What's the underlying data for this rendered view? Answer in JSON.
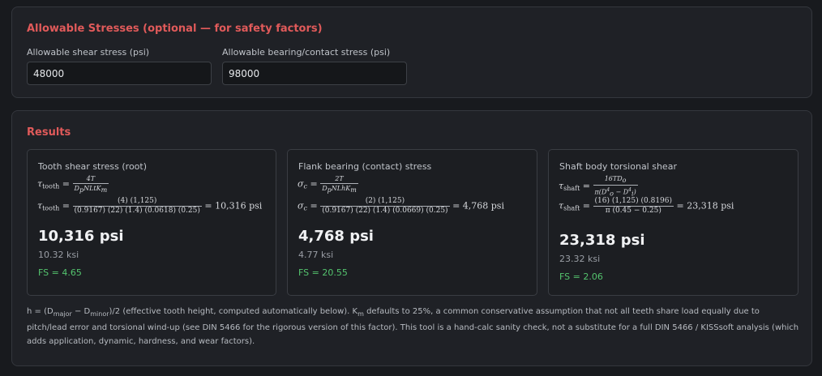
{
  "allowable": {
    "title": "Allowable Stresses (optional — for safety factors)",
    "shear_label": "Allowable shear stress (psi)",
    "shear_value": "48000",
    "bearing_label": "Allowable bearing/contact stress (psi)",
    "bearing_value": "98000"
  },
  "results": {
    "title": "Results",
    "cards": [
      {
        "title": "Tooth shear stress (root)",
        "sym": "τ",
        "sub": "tooth",
        "gen_num": "4T",
        "gen_den": "D",
        "gen_den_sub": "p",
        "gen_den_rest": "NLtK",
        "gen_den_sub2": "m",
        "num": "(4) (1,125)",
        "den": "(0.9167) (22) (1.4) (0.0618) (0.25)",
        "result": "= 10,316 psi",
        "big": "10,316 psi",
        "ksi": "10.32 ksi",
        "fs": "FS = 4.65"
      },
      {
        "title": "Flank bearing (contact) stress",
        "sym": "σ",
        "sub": "c",
        "gen_num": "2T",
        "gen_den": "D",
        "gen_den_sub": "p",
        "gen_den_rest": "NLhK",
        "gen_den_sub2": "m",
        "num": "(2) (1,125)",
        "den": "(0.9167) (22) (1.4) (0.0669) (0.25)",
        "result": "= 4,768 psi",
        "big": "4,768 psi",
        "ksi": "4.77 ksi",
        "fs": "FS = 20.55"
      },
      {
        "title": "Shaft body torsional shear",
        "sym": "τ",
        "sub": "shaft",
        "gen_num": "16TD",
        "gen_num_sub": "o",
        "gen_den": "π(D",
        "gen_den_p1": "4",
        "gen_den_sub": "o",
        "gen_den_rest": " − D",
        "gen_den_p2": "4",
        "gen_den_sub2": "i",
        "gen_den_end": ")",
        "num": "(16) (1,125) (0.8196)",
        "den": "π (0.45 − 0.25)",
        "result": "= 23,318 psi",
        "big": "23,318 psi",
        "ksi": "23.32 ksi",
        "fs": "FS = 2.06"
      }
    ],
    "note": {
      "p1": "h = (D",
      "s1": "major",
      "p2": " − D",
      "s2": "minor",
      "p3": ")/2 (effective tooth height, computed automatically below). K",
      "s3": "m",
      "p4": " defaults to 25%, a common conservative assumption that not all teeth share load equally due to pitch/lead error and torsional wind-up (see DIN 5466 for the rigorous version of this factor). This tool is a hand-calc sanity check, not a substitute for a full DIN 5466 / KISSsoft analysis (which adds application, dynamic, hardness, and wear factors)."
    }
  },
  "colors": {
    "accent": "#e05a5a",
    "good": "#54c46e",
    "bg": "#181a1e",
    "panel": "#1f2126"
  }
}
